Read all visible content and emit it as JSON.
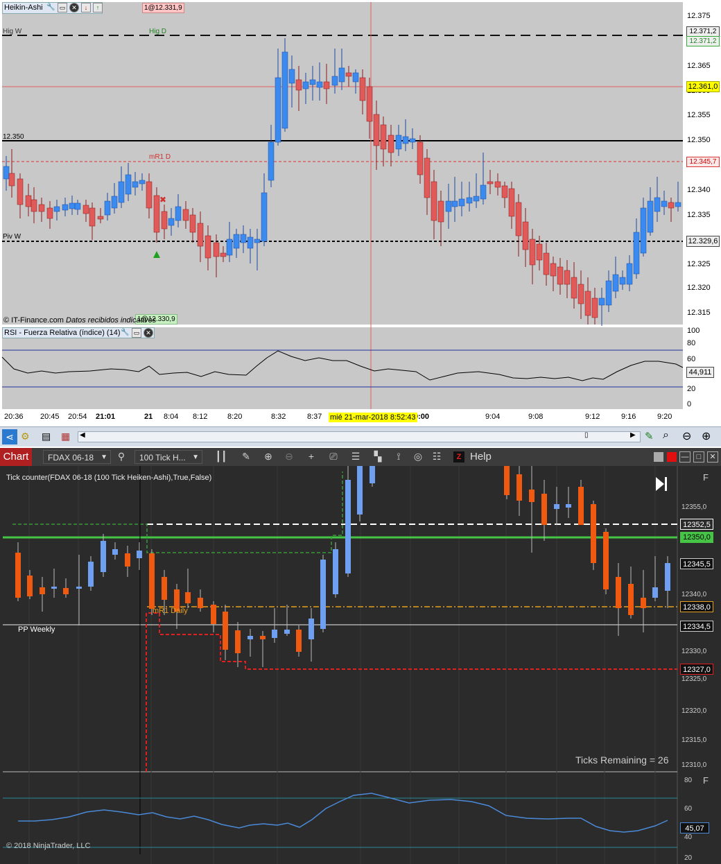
{
  "top_chart": {
    "title": "Heikin-Ashi",
    "order_tag_top": "1@12.331,9",
    "order_tag_bottom": "1@12.330,9",
    "copyright": "© IT-Finance.com",
    "status": "Datos recibidos indicativos",
    "line_labels": {
      "high_week": "Hig W",
      "high_day": "Hig D",
      "level_12350": "12.350",
      "mr1_day": "mR1 D",
      "pivot_week": "Piv W"
    },
    "price_axis": [
      "12.375",
      "12.365",
      "12.360",
      "12.355",
      "12.350",
      "12.345",
      "12.340",
      "12.335",
      "12.330",
      "12.325",
      "12.320",
      "12.315"
    ],
    "price_boxes": {
      "high_w": "12.371,2",
      "high_d": "12.371,2",
      "cursor": "12.361,0",
      "mr1": "12.345,7",
      "pivot": "12.329,6"
    },
    "rsi_title": "RSI - Fuerza Relativa (índice) (14)",
    "rsi_axis": [
      "100",
      "80",
      "60",
      "40",
      "20",
      "0"
    ],
    "rsi_value": "44,911",
    "time_axis": [
      "20:36",
      "20:45",
      "20:54",
      "21:01",
      "21",
      "8:04",
      "8:12",
      "8:20",
      "8:32",
      "8:37",
      "9:00",
      "9:04",
      "9:08",
      "9:12",
      "9:16",
      "9:20"
    ],
    "cursor_time": "mié 21-mar-2018 8:52:43"
  },
  "bottom_chart": {
    "app_tab": "Chart",
    "instrument": "FDAX 06-18",
    "bar_type": "100 Tick H...",
    "help": "Help",
    "indicator_label": "Tick counter(FDAX 06-18 (100 Tick Heiken-Ashi),True,False)",
    "pp_weekly": "PP Weekly",
    "mr1_daily": "mR1 Daily",
    "ticks_remaining": "Ticks Remaining = 26",
    "copyright": "© 2018 NinjaTrader, LLC",
    "f_label": "F",
    "price_axis": [
      "12355,0",
      "12350,0",
      "12340,0",
      "12330,0",
      "12325,0",
      "12320,0",
      "12315,0",
      "12310,0"
    ],
    "price_boxes": {
      "white_dash": "12352,5",
      "green": "12350,0",
      "last": "12345,5",
      "orange": "12338,0",
      "pp": "12334,5",
      "red": "12327,0"
    },
    "rsi_axis": [
      "80",
      "60",
      "40",
      "20"
    ],
    "rsi_value": "45,07"
  }
}
